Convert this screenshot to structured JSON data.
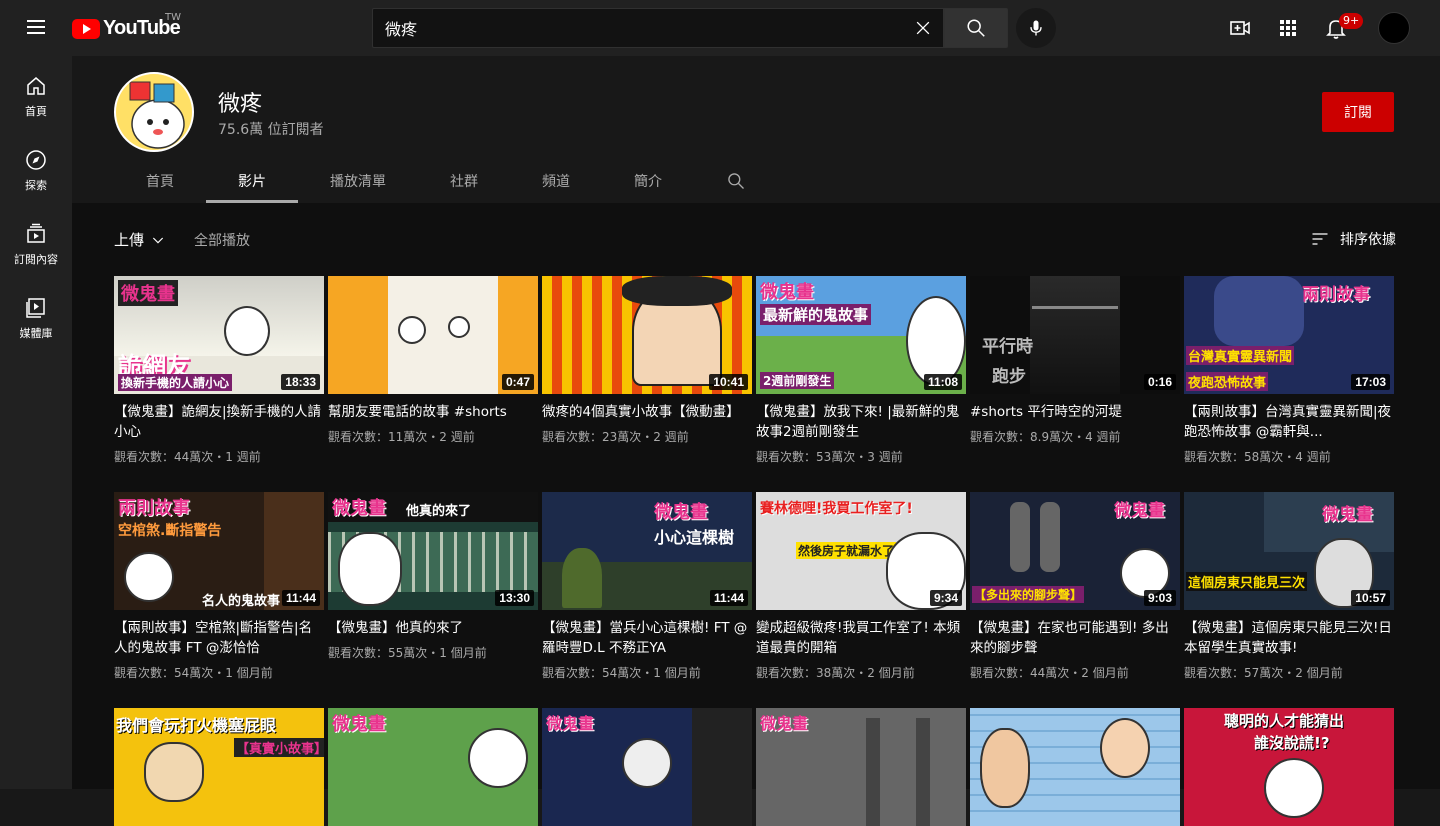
{
  "header": {
    "logo_text": "YouTube",
    "region": "TW",
    "search_value": "微疼",
    "notif_count": "9+"
  },
  "sidebar": {
    "items": [
      {
        "label": "首頁",
        "icon": "home-icon"
      },
      {
        "label": "探索",
        "icon": "compass-icon"
      },
      {
        "label": "訂閱內容",
        "icon": "subscriptions-icon"
      },
      {
        "label": "媒體庫",
        "icon": "library-icon"
      }
    ]
  },
  "channel": {
    "name": "微疼",
    "subscribers": "75.6萬 位訂閱者",
    "subscribe_label": "訂閱",
    "tabs": [
      "首頁",
      "影片",
      "播放清單",
      "社群",
      "頻道",
      "簡介"
    ],
    "active_tab": "影片"
  },
  "filter": {
    "upload_label": "上傳",
    "play_all": "全部播放",
    "sort_label": "排序依據"
  },
  "videos": [
    {
      "title": "【微鬼畫】詭網友|換新手機的人請小心",
      "views": "觀看次數：44萬次・1 週前",
      "duration": "18:33"
    },
    {
      "title": "幫朋友要電話的故事 #shorts",
      "views": "觀看次數：11萬次・2 週前",
      "duration": "0:47"
    },
    {
      "title": "微疼的4個真實小故事【微動畫】",
      "views": "觀看次數：23萬次・2 週前",
      "duration": "10:41"
    },
    {
      "title": "【微鬼畫】放我下來! |最新鮮的鬼故事2週前剛發生",
      "views": "觀看次數：53萬次・3 週前",
      "duration": "11:08"
    },
    {
      "title": "#shorts 平行時空的河堤",
      "views": "觀看次數：8.9萬次・4 週前",
      "duration": "0:16"
    },
    {
      "title": "【兩則故事】台灣真實靈異新聞|夜跑恐怖故事 @霸軒與...",
      "views": "觀看次數：58萬次・4 週前",
      "duration": "17:03"
    },
    {
      "title": "【兩則故事】空棺煞|斷指警告|名人的鬼故事 FT @澎恰恰",
      "views": "觀看次數：54萬次・1 個月前",
      "duration": "11:44"
    },
    {
      "title": "【微鬼畫】他真的來了",
      "views": "觀看次數：55萬次・1 個月前",
      "duration": "13:30"
    },
    {
      "title": "【微鬼畫】當兵小心這棵樹! FT @羅時豐D.L 不務正YA",
      "views": "觀看次數：54萬次・1 個月前",
      "duration": "11:44"
    },
    {
      "title": "變成超級微疼!我買工作室了! 本頻道最貴的開箱",
      "views": "觀看次數：38萬次・2 個月前",
      "duration": "9:34"
    },
    {
      "title": "【微鬼畫】在家也可能遇到! 多出來的腳步聲",
      "views": "觀看次數：44萬次・2 個月前",
      "duration": "9:03"
    },
    {
      "title": "【微鬼畫】這個房東只能見三次!日本留學生真實故事!",
      "views": "觀看次數：57萬次・2 個月前",
      "duration": "10:57"
    }
  ],
  "thumb_captions": {
    "t1a": "微鬼畫",
    "t1b": "詭網友",
    "t1c": "換新手機的人請小心",
    "t4a": "微鬼畫",
    "t4b": "最新鮮的鬼故事",
    "t4c": "2週前剛發生",
    "t5a": "平行時",
    "t5b": "跑步",
    "t6a": "兩則故事",
    "t6b": "台灣真實靈異新聞",
    "t6c": "夜跑恐怖故事",
    "t7a": "兩則故事",
    "t7b": "空棺煞.斷指警告",
    "t7c": "名人的鬼故事",
    "t8a": "微鬼畫",
    "t8b": "他真的來了",
    "t9a": "微鬼畫",
    "t9b": "小心這棵樹",
    "t10a": "賽林德哩!我買工作室了!",
    "t10b": "然後房子就漏水了",
    "t11a": "微鬼畫",
    "t11b": "【多出來的腳步聲】",
    "t12a": "微鬼畫",
    "t12b": "這個房東只能見三次",
    "r3a": "我們會玩打火機塞屁眼",
    "r3b": "【真實小故事】",
    "r3c": "微鬼畫",
    "r3d": "微鬼畫",
    "r3e": "微鬼畫",
    "r3f": "聰明的人才能猜出",
    "r3g": "誰沒說謊!?"
  }
}
